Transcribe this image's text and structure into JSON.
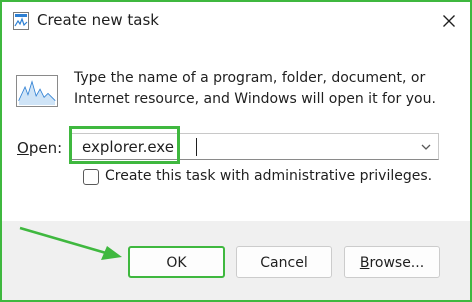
{
  "window": {
    "title": "Create new task",
    "close_icon": "close-icon"
  },
  "description": "Type the name of a program, folder, document, or Internet resource, and Windows will open it for you.",
  "open": {
    "label_underlined": "O",
    "label_rest": "pen:",
    "value": "explorer.exe"
  },
  "admin_checkbox": {
    "label": "Create this task with administrative privileges.",
    "checked": false
  },
  "buttons": {
    "ok": "OK",
    "cancel": "Cancel",
    "browse_underlined": "B",
    "browse_rest": "rowse..."
  },
  "colors": {
    "highlight": "#3fb83f",
    "footer_bg": "#f0f0f0"
  }
}
